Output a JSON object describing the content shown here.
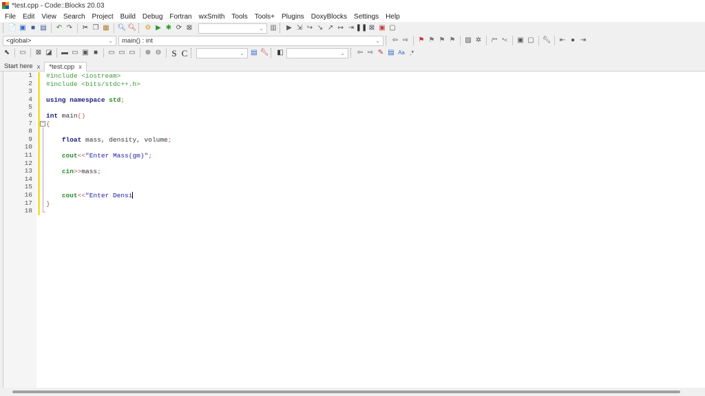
{
  "window": {
    "title": "*test.cpp - Code::Blocks 20.03"
  },
  "menu": [
    "File",
    "Edit",
    "View",
    "Search",
    "Project",
    "Build",
    "Debug",
    "Fortran",
    "wxSmith",
    "Tools",
    "Tools+",
    "Plugins",
    "DoxyBlocks",
    "Settings",
    "Help"
  ],
  "scope": {
    "global": "<global>",
    "function": "main() : int"
  },
  "tabs": [
    {
      "label": "Start here",
      "close": "x"
    },
    {
      "label": "*test.cpp",
      "close": "x"
    }
  ],
  "toolbar": {
    "s_label": "S",
    "c_label": "C",
    "regex_label": ".*"
  },
  "code": [
    [
      [
        "pp",
        "#include <iostream>"
      ]
    ],
    [
      [
        "pp",
        "#include <bits/stdc++.h>"
      ]
    ],
    [],
    [
      [
        "kw",
        "using namespace "
      ],
      [
        "lib",
        "std"
      ],
      [
        "op",
        ";"
      ]
    ],
    [],
    [
      [
        "ty",
        "int"
      ],
      [
        "id",
        " main"
      ],
      [
        "op",
        "()"
      ]
    ],
    [
      [
        "op",
        "{"
      ]
    ],
    [],
    [
      [
        "id",
        "    "
      ],
      [
        "ty",
        "float"
      ],
      [
        "id",
        " mass, density, volume"
      ],
      [
        "op",
        ";"
      ]
    ],
    [],
    [
      [
        "id",
        "    "
      ],
      [
        "lib",
        "cout"
      ],
      [
        "op",
        "<<"
      ],
      [
        "str",
        "\"Enter Mass(gm)\""
      ],
      [
        "op",
        ";"
      ]
    ],
    [],
    [
      [
        "id",
        "    "
      ],
      [
        "lib",
        "cin"
      ],
      [
        "op",
        ">>"
      ],
      [
        "id",
        "mass"
      ],
      [
        "op",
        ";"
      ]
    ],
    [],
    [],
    [
      [
        "id",
        "    "
      ],
      [
        "lib",
        "cout"
      ],
      [
        "op",
        "<<"
      ],
      [
        "str",
        "\"Enter Densi"
      ]
    ],
    [
      [
        "op",
        "}"
      ]
    ],
    []
  ]
}
